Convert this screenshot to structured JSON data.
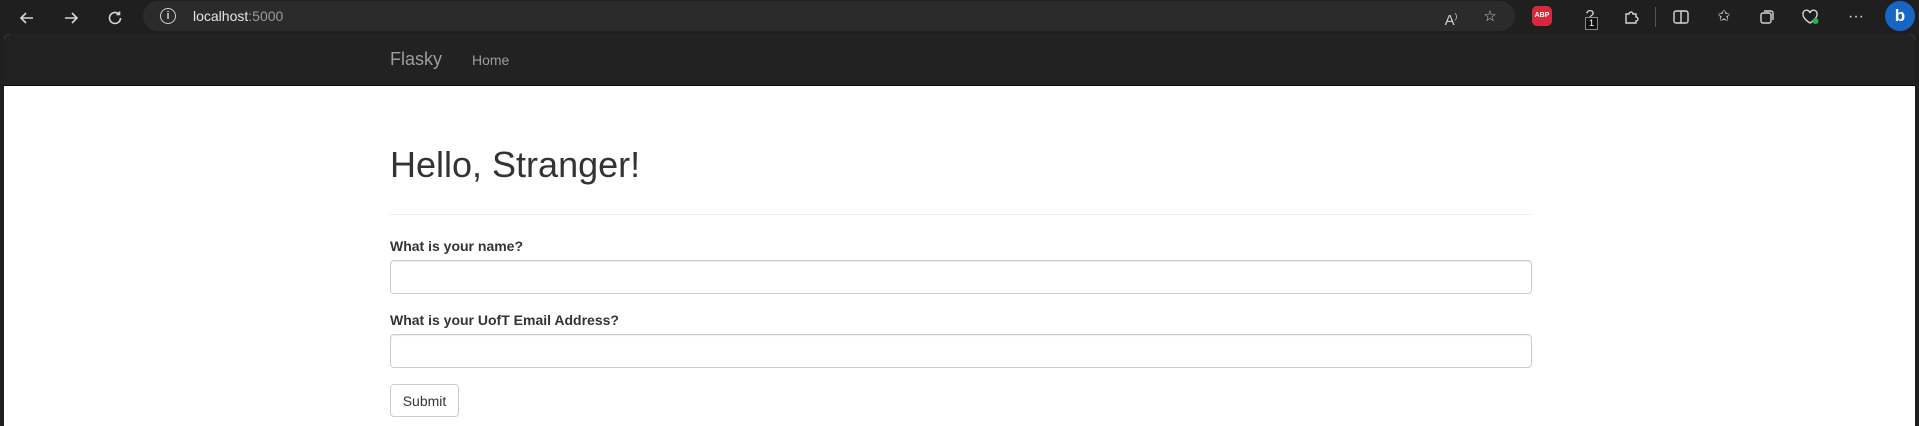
{
  "browser": {
    "url_host": "localhost",
    "url_port": ":5000",
    "abp_label": "ABP",
    "extension_badge": "1"
  },
  "navbar": {
    "brand": "Flasky",
    "items": [
      {
        "label": "Home"
      }
    ]
  },
  "main": {
    "heading": "Hello, Stranger!",
    "form": {
      "name_label": "What is your name?",
      "name_value": "",
      "email_label": "What is your UofT Email Address?",
      "email_value": "",
      "submit_label": "Submit"
    }
  },
  "colors": {
    "navbar_bg": "#222222",
    "navbar_text": "#9d9d9d",
    "browser_bg": "#1f1f1f",
    "page_bg": "#ffffff"
  }
}
